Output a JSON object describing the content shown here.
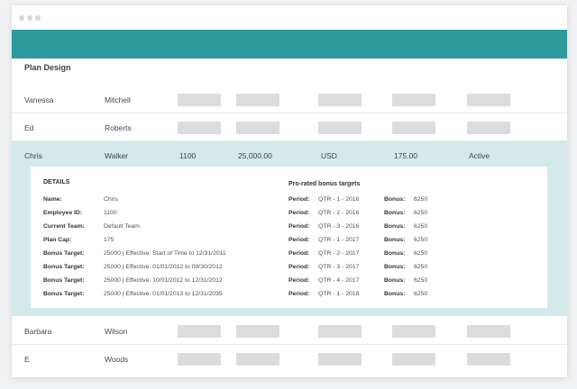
{
  "plan_design": {
    "title": "Plan Design"
  },
  "rows_top": [
    {
      "first": "Vanessa",
      "last": "Mitchell"
    },
    {
      "first": "Ed",
      "last": "Roberts"
    }
  ],
  "active_row": {
    "first": "Chris",
    "last": "Walker",
    "employee_id": "1100",
    "amount": "25,000.00",
    "currency": "USD",
    "bonus": "175.00",
    "status": "Active"
  },
  "details": {
    "title": "DETAILS",
    "fields": [
      {
        "label": "Name:",
        "value": "Chris"
      },
      {
        "label": "Employee ID:",
        "value": "1100"
      },
      {
        "label": "Current Team:",
        "value": "Default Team"
      },
      {
        "label": "Plan Cap:",
        "value": "175"
      },
      {
        "label": "Bonus Target:",
        "value": "25000  |  Effective: Start of Time to 12/31/2011"
      },
      {
        "label": "Bonus Target:",
        "value": "25000  |  Effective: 01/01/2012 to 09/30/2012"
      },
      {
        "label": "Bonus Target:",
        "value": "25000  |  Effective: 10/01/2012 to 12/31/2012"
      },
      {
        "label": "Bonus Target:",
        "value": "25000  |  Effective: 01/01/2013 to 12/31/2035"
      }
    ]
  },
  "prorated": {
    "title": "Pro-rated bonus targets",
    "period_label": "Period:",
    "bonus_label": "Bonus:",
    "items": [
      {
        "period": "QTR - 1 - 2016",
        "bonus": "6250"
      },
      {
        "period": "QTR - 2 - 2016",
        "bonus": "6250"
      },
      {
        "period": "QTR - 3 - 2016",
        "bonus": "6250"
      },
      {
        "period": "QTR - 1 - 2017",
        "bonus": "6250"
      },
      {
        "period": "QTR - 2 - 2017",
        "bonus": "6250"
      },
      {
        "period": "QTR - 3 - 2017",
        "bonus": "6250"
      },
      {
        "period": "QTR - 4 - 2017",
        "bonus": "6250"
      },
      {
        "period": "QTR - 1 - 2018",
        "bonus": "6250"
      }
    ]
  },
  "rows_bottom": [
    {
      "first": "Barbara",
      "last": "Wilson"
    },
    {
      "first": "E",
      "last": "Woods"
    }
  ],
  "colors": {
    "header": "#2d9b9b",
    "active_row": "#d4e9ec",
    "placeholder": "#dadcde"
  }
}
